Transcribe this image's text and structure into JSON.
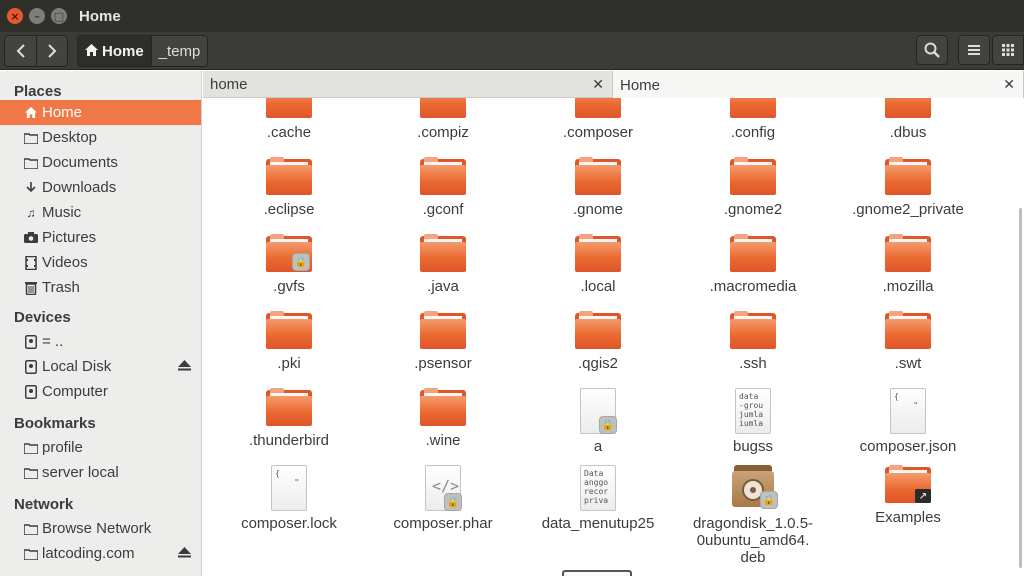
{
  "window": {
    "title": "Home"
  },
  "toolbar": {
    "breadcrumbs": [
      {
        "label": "Home",
        "icon": "home-icon"
      },
      {
        "label": "_temp"
      }
    ]
  },
  "sidebar": {
    "places": {
      "heading": "Places",
      "items": [
        {
          "label": "Home",
          "icon": "home-icon"
        },
        {
          "label": "Desktop",
          "icon": "desktop-icon"
        },
        {
          "label": "Documents",
          "icon": "documents-icon"
        },
        {
          "label": "Downloads",
          "icon": "downloads-icon"
        },
        {
          "label": "Music",
          "icon": "music-icon"
        },
        {
          "label": "Pictures",
          "icon": "pictures-icon"
        },
        {
          "label": "Videos",
          "icon": "videos-icon"
        },
        {
          "label": "Trash",
          "icon": "trash-icon"
        }
      ]
    },
    "devices": {
      "heading": "Devices",
      "items": [
        {
          "label": "= ..",
          "icon": "drive-icon"
        },
        {
          "label": "Local Disk",
          "icon": "drive-icon"
        },
        {
          "label": "Computer",
          "icon": "drive-icon"
        }
      ]
    },
    "bookmarks": {
      "heading": "Bookmarks",
      "items": [
        {
          "label": "profile",
          "icon": "folder-icon"
        },
        {
          "label": "server local",
          "icon": "folder-icon"
        }
      ]
    },
    "network": {
      "heading": "Network",
      "items": [
        {
          "label": "Browse Network",
          "icon": "network-icon"
        },
        {
          "label": "latcoding.com",
          "icon": "folder-icon"
        }
      ]
    }
  },
  "tabs": [
    {
      "label": "home"
    },
    {
      "label": "Home"
    }
  ],
  "files": [
    {
      "name": ".cache",
      "type": "folder"
    },
    {
      "name": ".compiz",
      "type": "folder"
    },
    {
      "name": ".composer",
      "type": "folder"
    },
    {
      "name": ".config",
      "type": "folder"
    },
    {
      "name": ".dbus",
      "type": "folder"
    },
    {
      "name": ".eclipse",
      "type": "folder"
    },
    {
      "name": ".gconf",
      "type": "folder"
    },
    {
      "name": ".gnome",
      "type": "folder"
    },
    {
      "name": ".gnome2",
      "type": "folder"
    },
    {
      "name": ".gnome2_private",
      "type": "folder"
    },
    {
      "name": ".gvfs",
      "type": "folder-locked"
    },
    {
      "name": ".java",
      "type": "folder"
    },
    {
      "name": ".local",
      "type": "folder"
    },
    {
      "name": ".macromedia",
      "type": "folder"
    },
    {
      "name": ".mozilla",
      "type": "folder"
    },
    {
      "name": ".pki",
      "type": "folder"
    },
    {
      "name": ".psensor",
      "type": "folder"
    },
    {
      "name": ".qgis2",
      "type": "folder"
    },
    {
      "name": ".ssh",
      "type": "folder"
    },
    {
      "name": ".swt",
      "type": "folder"
    },
    {
      "name": ".thunderbird",
      "type": "folder"
    },
    {
      "name": ".wine",
      "type": "folder"
    },
    {
      "name": "a",
      "type": "doc-locked",
      "preview": ""
    },
    {
      "name": "bugss",
      "type": "doc",
      "preview": "data\n-grou\njumla\niumla"
    },
    {
      "name": "composer.json",
      "type": "doc",
      "preview": "{\n    \""
    },
    {
      "name": "composer.lock",
      "type": "doc",
      "preview": "{\n    \""
    },
    {
      "name": "composer.phar",
      "type": "doc-locked",
      "preview": "</>"
    },
    {
      "name": "data_menutup25",
      "type": "doc",
      "preview": "Data\nanggo\nrecor\npriva"
    },
    {
      "name": "dragondisk_1.0.5-\n0ubuntu_amd64.\ndeb",
      "type": "deb-locked"
    },
    {
      "name": "Examples",
      "type": "folder-link"
    }
  ]
}
